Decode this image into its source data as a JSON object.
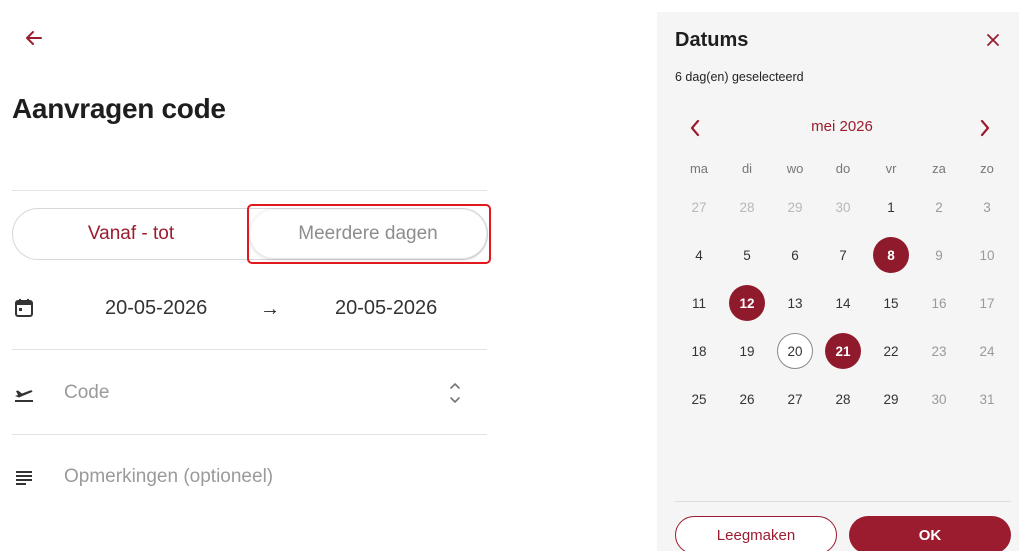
{
  "form": {
    "title": "Aanvragen code",
    "toggle": {
      "option_range": "Vanaf - tot",
      "option_multi": "Meerdere dagen"
    },
    "date_from": "20-05-2026",
    "date_to": "20-05-2026",
    "arrow": "→",
    "code_placeholder": "Code",
    "remarks_placeholder": "Opmerkingen (optioneel)"
  },
  "panel": {
    "title": "Datums",
    "subtitle": "6 dag(en) geselecteerd",
    "month": "mei 2026",
    "weekdays": [
      "ma",
      "di",
      "wo",
      "do",
      "vr",
      "za",
      "zo"
    ],
    "weeks": [
      [
        "27",
        "28",
        "29",
        "30",
        "1",
        "2",
        "3"
      ],
      [
        "4",
        "5",
        "6",
        "7",
        "8",
        "9",
        "10"
      ],
      [
        "11",
        "12",
        "13",
        "14",
        "15",
        "16",
        "17"
      ],
      [
        "18",
        "19",
        "20",
        "21",
        "22",
        "23",
        "24"
      ],
      [
        "25",
        "26",
        "27",
        "28",
        "29",
        "30",
        "31"
      ]
    ],
    "selected_days": [
      "8",
      "12",
      "21"
    ],
    "today_day": "20",
    "clear_label": "Leegmaken",
    "ok_label": "OK"
  },
  "colors": {
    "accent": "#9b1c2e",
    "highlight": "#e0191e",
    "panel_bg": "#f5f5f5"
  }
}
